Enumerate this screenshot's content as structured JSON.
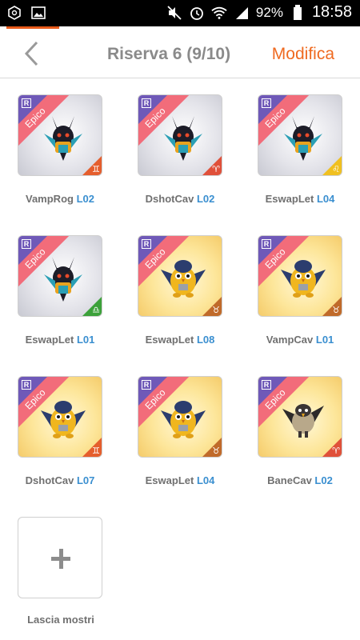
{
  "status_bar": {
    "battery": "92%",
    "time": "18:58",
    "icons_left": [
      "hexagon-app-icon",
      "image-icon"
    ],
    "icons_right": [
      "mute-icon",
      "alarm-icon",
      "wifi-icon",
      "signal-icon",
      "battery-icon"
    ]
  },
  "header": {
    "title": "Riserva 6 (9/10)",
    "edit_label": "Modifica",
    "back_icon": "chevron-left-icon"
  },
  "colors": {
    "accent": "#ef6a20",
    "level_blue": "#3a8fd0",
    "rarity_ribbon": "#f26c7a",
    "rare_badge": "#6f59b8"
  },
  "monsters": [
    {
      "name": "VampRog",
      "level": "L02",
      "rarity": "Epico",
      "rank": "R",
      "zodiac_symbol": "♊",
      "bg": "gray",
      "zodiac_color": "orange",
      "creature": "anubis-icon"
    },
    {
      "name": "DshotCav",
      "level": "L02",
      "rarity": "Epico",
      "rank": "R",
      "zodiac_symbol": "♈",
      "bg": "gray",
      "zodiac_color": "red",
      "creature": "anubis-icon"
    },
    {
      "name": "EswapLet",
      "level": "L04",
      "rarity": "Epico",
      "rank": "R",
      "zodiac_symbol": "♌",
      "bg": "gray",
      "zodiac_color": "yellow",
      "creature": "anubis-icon"
    },
    {
      "name": "EswapLet",
      "level": "L01",
      "rarity": "Epico",
      "rank": "R",
      "zodiac_symbol": "♎",
      "bg": "gray",
      "zodiac_color": "green",
      "creature": "anubis-icon"
    },
    {
      "name": "EswapLet",
      "level": "L08",
      "rarity": "Epico",
      "rank": "R",
      "zodiac_symbol": "♉",
      "bg": "gold",
      "zodiac_color": "brown",
      "creature": "owl-bear-icon"
    },
    {
      "name": "VampCav",
      "level": "L01",
      "rarity": "Epico",
      "rank": "R",
      "zodiac_symbol": "♉",
      "bg": "gold",
      "zodiac_color": "brown",
      "creature": "owl-bear-icon"
    },
    {
      "name": "DshotCav",
      "level": "L07",
      "rarity": "Epico",
      "rank": "R",
      "zodiac_symbol": "♊",
      "bg": "gold",
      "zodiac_color": "orange",
      "creature": "owl-bear-icon"
    },
    {
      "name": "EswapLet",
      "level": "L04",
      "rarity": "Epico",
      "rank": "R",
      "zodiac_symbol": "♉",
      "bg": "gold",
      "zodiac_color": "brown",
      "creature": "owl-bear-icon"
    },
    {
      "name": "BaneCav",
      "level": "L02",
      "rarity": "Epico",
      "rank": "R",
      "zodiac_symbol": "♈",
      "bg": "gold",
      "zodiac_color": "red",
      "creature": "crow-icon"
    }
  ],
  "add_slot": {
    "label": "Lascia mostri",
    "icon": "plus-icon"
  }
}
